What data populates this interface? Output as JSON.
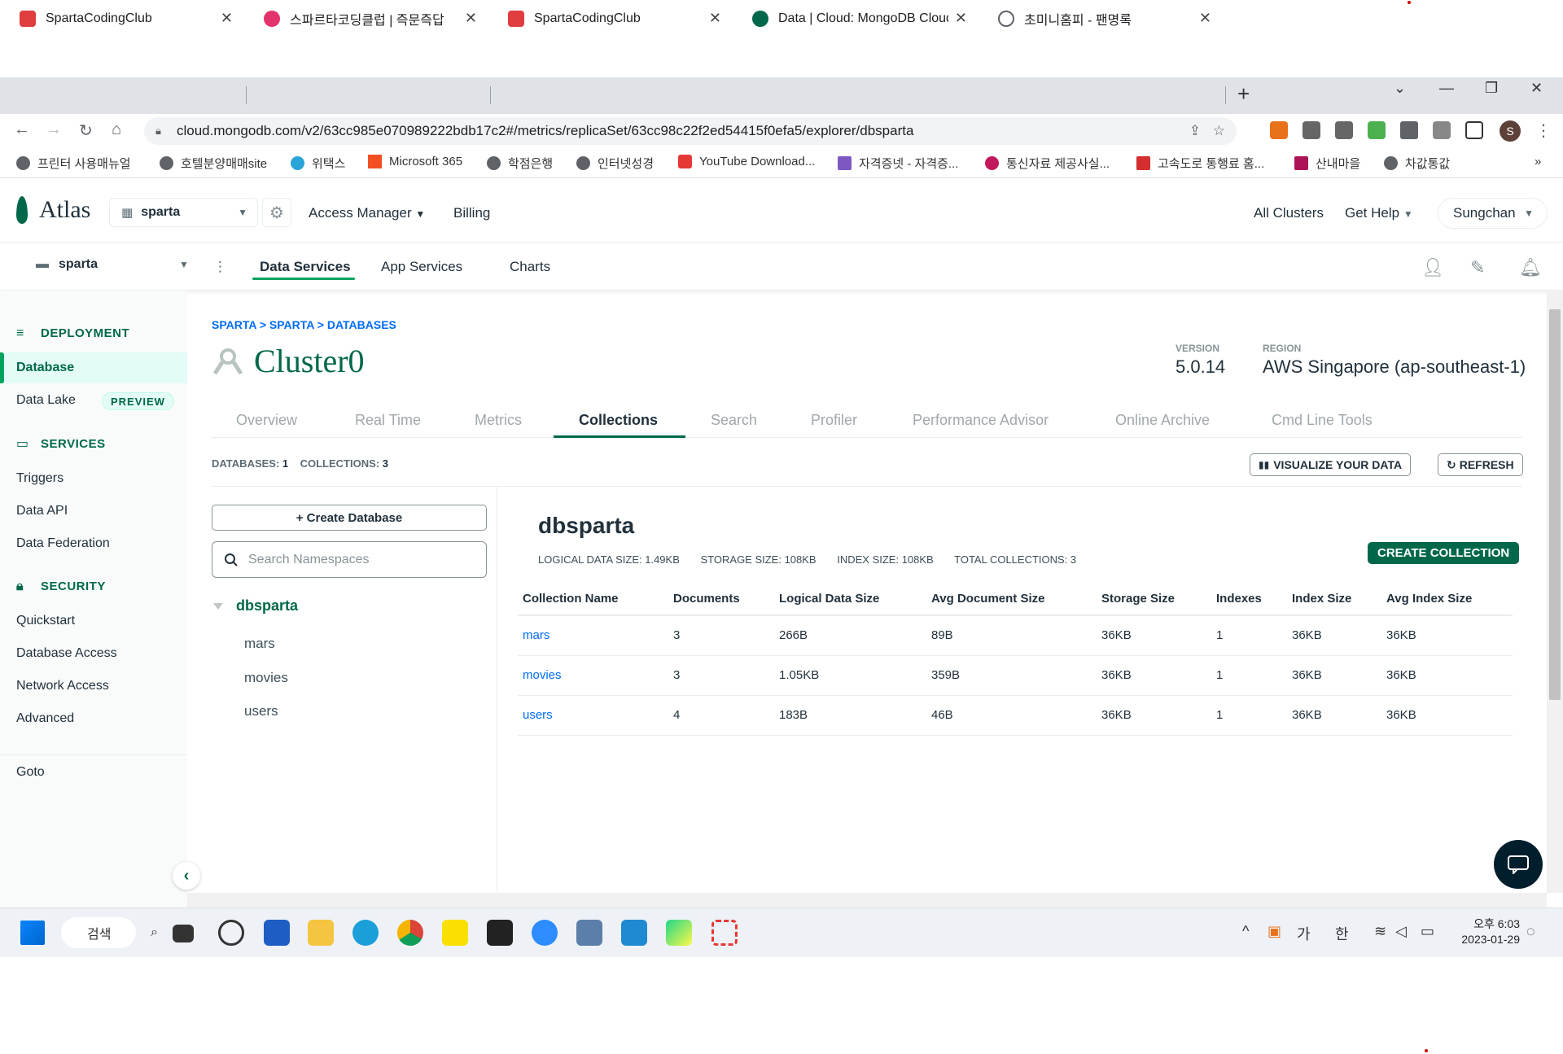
{
  "browser": {
    "tabs": [
      {
        "title": "SpartaCodingClub",
        "color": "#e03e3e"
      },
      {
        "title": "스파르타코딩클럽 | 즉문즉답",
        "color": "#e2336b"
      },
      {
        "title": "SpartaCodingClub",
        "color": "#e03e3e"
      },
      {
        "title": "Data | Cloud: MongoDB Cloud",
        "color": "#00684a"
      },
      {
        "title": "초미니홈피 - 팬명록",
        "color": "#5f6368"
      }
    ],
    "url": "cloud.mongodb.com/v2/63cc985e070989222bdb17c2#/metrics/replicaSet/63cc98c22f2ed54415f0efa5/explorer/dbsparta",
    "profile_initial": "S",
    "bookmarks": [
      {
        "label": "프린터 사용매뉴얼",
        "color": "#5f6368"
      },
      {
        "label": "호텔분양매매site",
        "color": "#5f6368"
      },
      {
        "label": "위택스",
        "color": "#2aa3d8"
      },
      {
        "label": "Microsoft 365",
        "color": "#f25022"
      },
      {
        "label": "학점은행",
        "color": "#5f6368"
      },
      {
        "label": "인터넷성경",
        "color": "#5f6368"
      },
      {
        "label": "YouTube Download...",
        "color": "#e53935"
      },
      {
        "label": "자격증넷 - 자격증...",
        "color": "#7e57c2"
      },
      {
        "label": "통신자료 제공사실...",
        "color": "#c2185b"
      },
      {
        "label": "고속도로 통행료 홈...",
        "color": "#d32f2f"
      },
      {
        "label": "산내마을",
        "color": "#ad1457"
      },
      {
        "label": "차값통값",
        "color": "#5f6368"
      }
    ],
    "bookmarks_more": "»"
  },
  "atlas": {
    "logo_text": "Atlas",
    "org": "sparta",
    "header_links": [
      "Access Manager",
      "Billing"
    ],
    "right_links": [
      "All Clusters",
      "Get Help"
    ],
    "user": "Sungchan",
    "project": "sparta",
    "subnav": [
      "Data Services",
      "App Services",
      "Charts"
    ]
  },
  "sidebar": {
    "deployment_label": "DEPLOYMENT",
    "database": "Database",
    "data_lake": "Data Lake",
    "preview_badge": "PREVIEW",
    "services_label": "SERVICES",
    "services": [
      "Triggers",
      "Data API",
      "Data Federation"
    ],
    "security_label": "SECURITY",
    "security": [
      "Quickstart",
      "Database Access",
      "Network Access",
      "Advanced"
    ],
    "goto": "Goto"
  },
  "cluster": {
    "breadcrumb": "SPARTA > SPARTA > DATABASES",
    "name": "Cluster0",
    "version_label": "VERSION",
    "version": "5.0.14",
    "region_label": "REGION",
    "region": "AWS Singapore (ap-southeast-1)",
    "tabs": [
      "Overview",
      "Real Time",
      "Metrics",
      "Collections",
      "Search",
      "Profiler",
      "Performance Advisor",
      "Online Archive",
      "Cmd Line Tools"
    ],
    "active_tab": "Collections"
  },
  "collections_view": {
    "databases_label": "DATABASES:",
    "databases_count": "1",
    "collections_label": "COLLECTIONS:",
    "collections_count": "3",
    "visualize_btn": "VISUALIZE YOUR DATA",
    "refresh_btn": "REFRESH",
    "create_db_btn": "+ Create Database",
    "search_placeholder": "Search Namespaces",
    "tree_db": "dbsparta",
    "tree_collections": [
      "mars",
      "movies",
      "users"
    ],
    "db_title": "dbsparta",
    "stats": [
      "LOGICAL DATA SIZE: 1.49KB",
      "STORAGE SIZE: 108KB",
      "INDEX SIZE: 108KB",
      "TOTAL COLLECTIONS: 3"
    ],
    "create_collection_btn": "CREATE COLLECTION",
    "columns": [
      "Collection Name",
      "Documents",
      "Logical Data Size",
      "Avg Document Size",
      "Storage Size",
      "Indexes",
      "Index Size",
      "Avg Index Size"
    ],
    "rows": [
      [
        "mars",
        "3",
        "266B",
        "89B",
        "36KB",
        "1",
        "36KB",
        "36KB"
      ],
      [
        "movies",
        "3",
        "1.05KB",
        "359B",
        "36KB",
        "1",
        "36KB",
        "36KB"
      ],
      [
        "users",
        "4",
        "183B",
        "46B",
        "36KB",
        "1",
        "36KB",
        "36KB"
      ]
    ]
  },
  "taskbar": {
    "search_label": "검색",
    "ime1": "가",
    "ime2": "한",
    "time": "오후 6:03",
    "date": "2023-01-29"
  }
}
